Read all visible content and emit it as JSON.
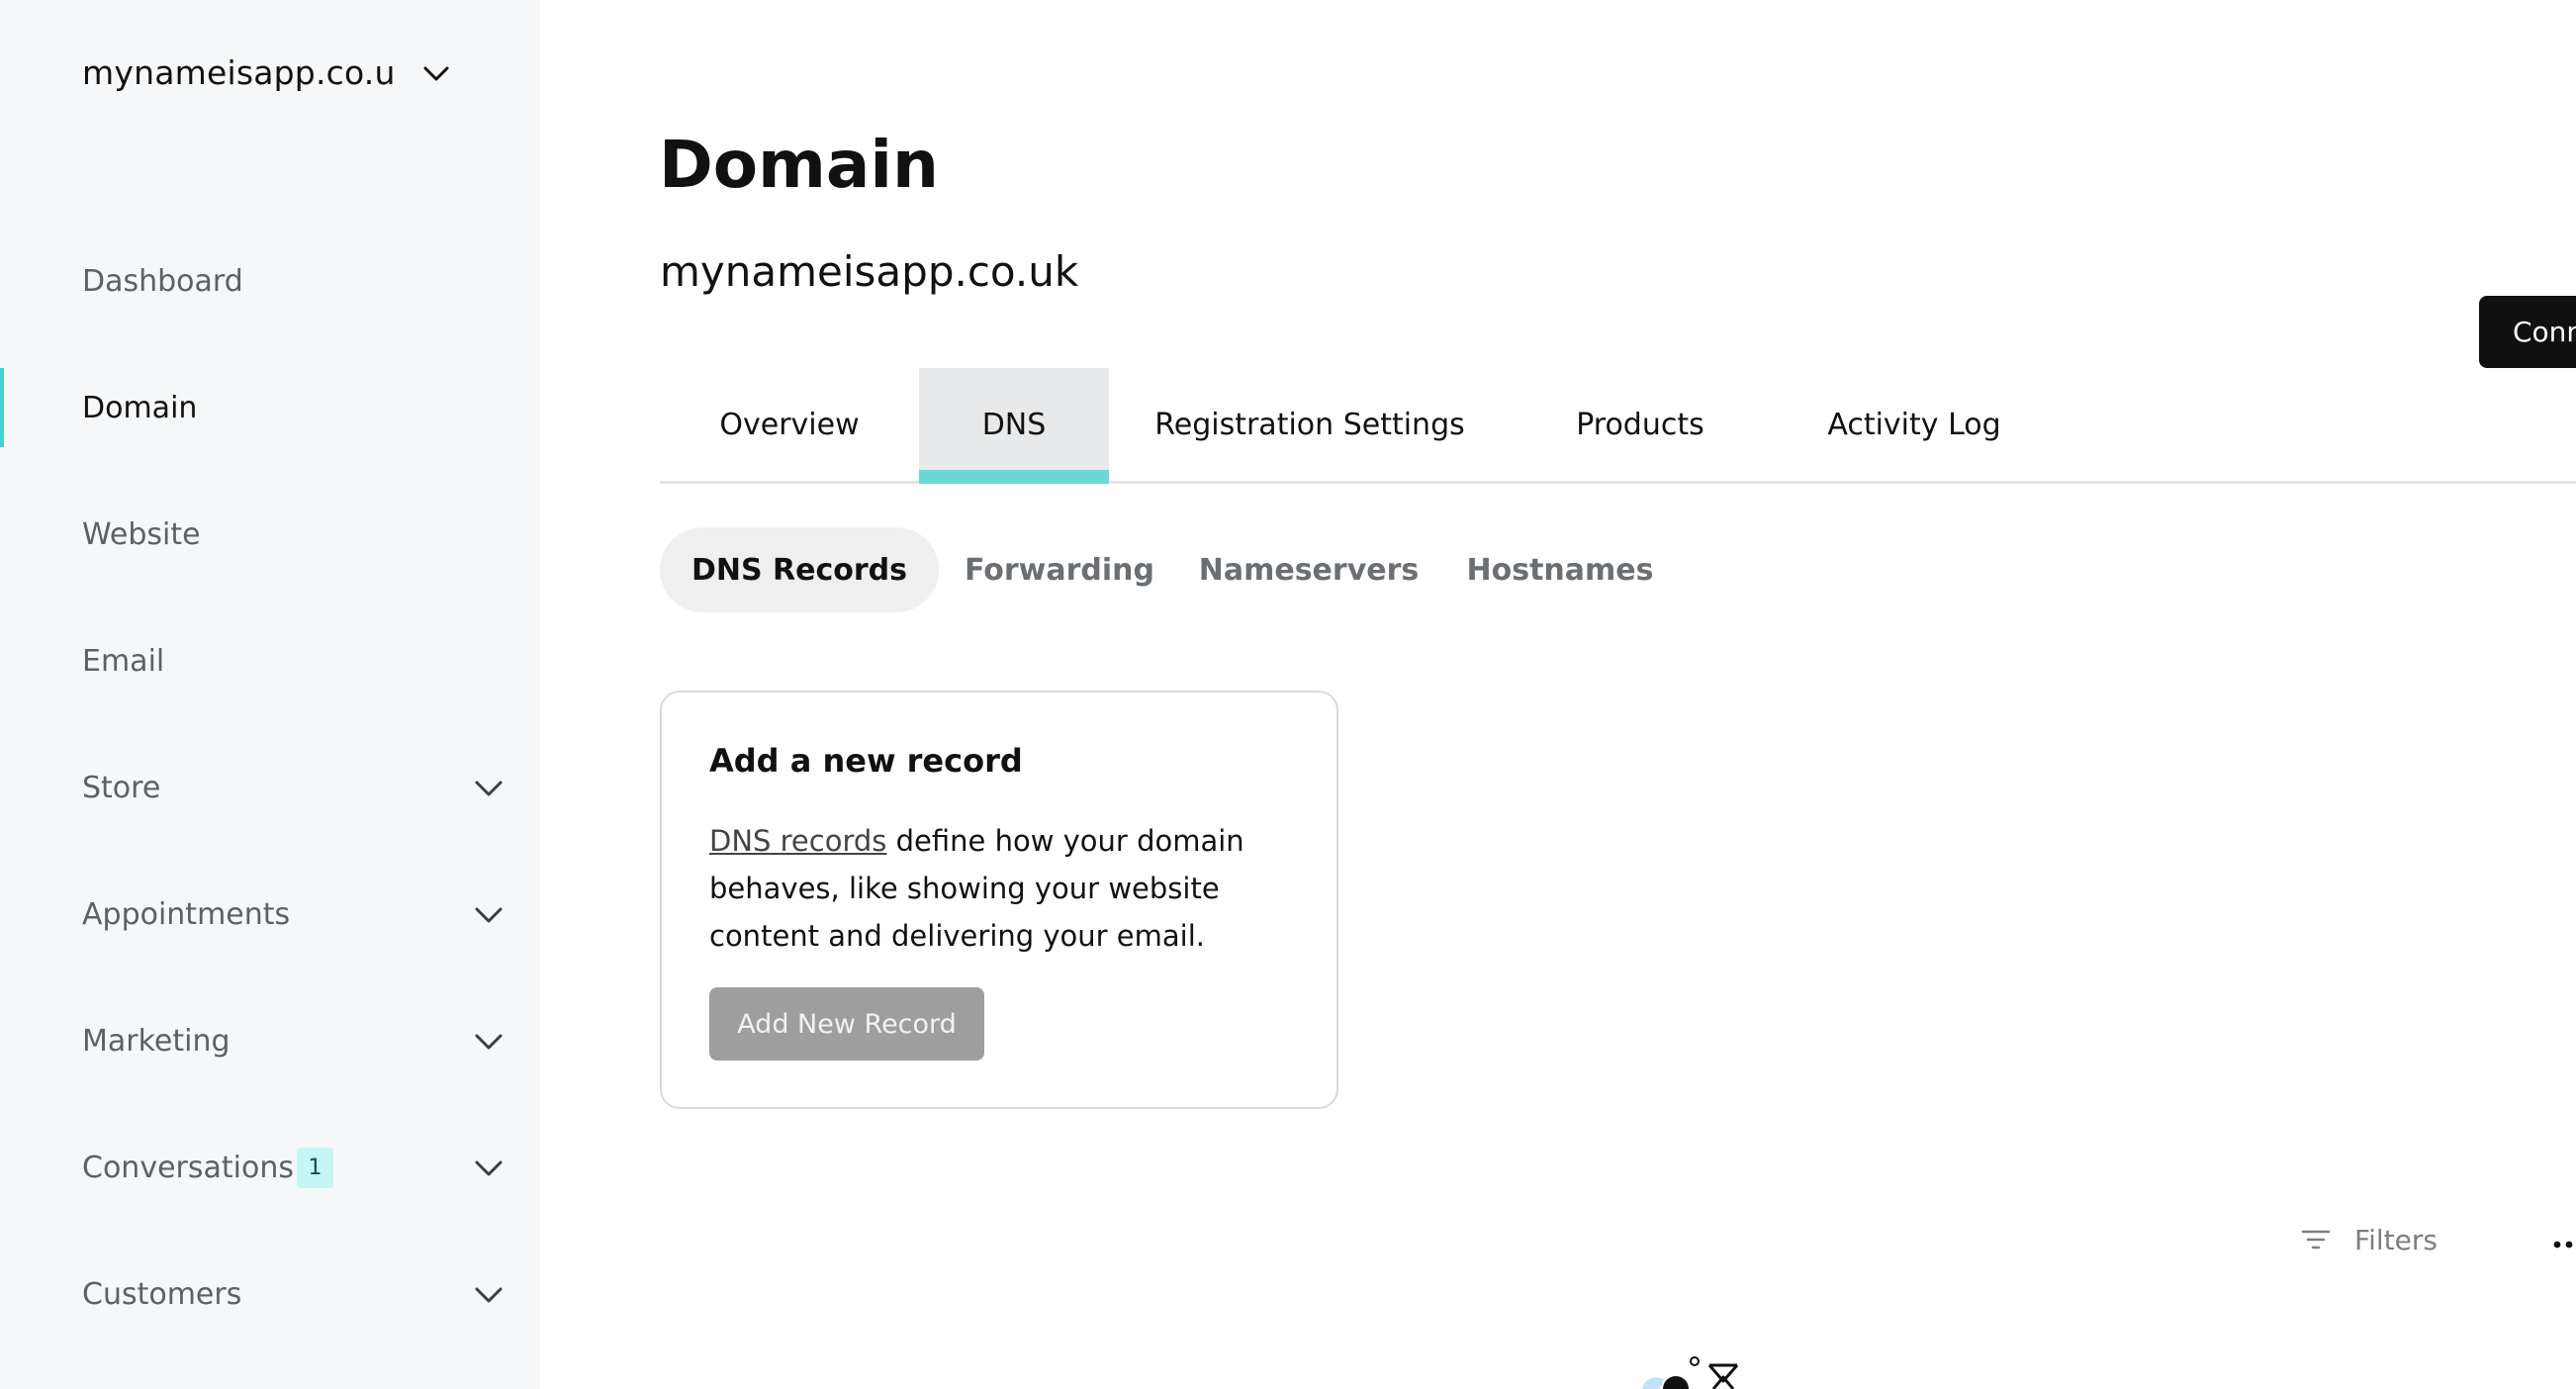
{
  "sidebar": {
    "site_name": "mynameisapp.co.u",
    "items": [
      {
        "label": "Dashboard"
      },
      {
        "label": "Domain"
      },
      {
        "label": "Website"
      },
      {
        "label": "Email"
      },
      {
        "label": "Store"
      },
      {
        "label": "Appointments"
      },
      {
        "label": "Marketing"
      },
      {
        "label": "Conversations",
        "badge": "1"
      },
      {
        "label": "Customers"
      }
    ],
    "active_item": "Domain",
    "accent_color": "#3fd4d0"
  },
  "header": {
    "title": "Domain",
    "domain": "mynameisapp.co.uk",
    "connect_label": "Conn"
  },
  "tabs": {
    "items": [
      {
        "label": "Overview"
      },
      {
        "label": "DNS"
      },
      {
        "label": "Registration Settings"
      },
      {
        "label": "Products"
      },
      {
        "label": "Activity Log"
      }
    ],
    "active": "DNS"
  },
  "subtabs": {
    "items": [
      {
        "label": "DNS Records"
      },
      {
        "label": "Forwarding"
      },
      {
        "label": "Nameservers"
      },
      {
        "label": "Hostnames"
      }
    ],
    "active": "DNS Records"
  },
  "card": {
    "title": "Add a new record",
    "link_text": "DNS records",
    "body_text": " define how your domain behaves, like showing your website content and delivering your email.",
    "button_label": "Add New Record"
  },
  "toolbar": {
    "filters_label": "Filters"
  },
  "icons": {
    "site_switcher": "chevron-down-icon",
    "expand": "chevron-down-icon",
    "filters": "filter-icon",
    "more": "more-horizontal-icon"
  }
}
